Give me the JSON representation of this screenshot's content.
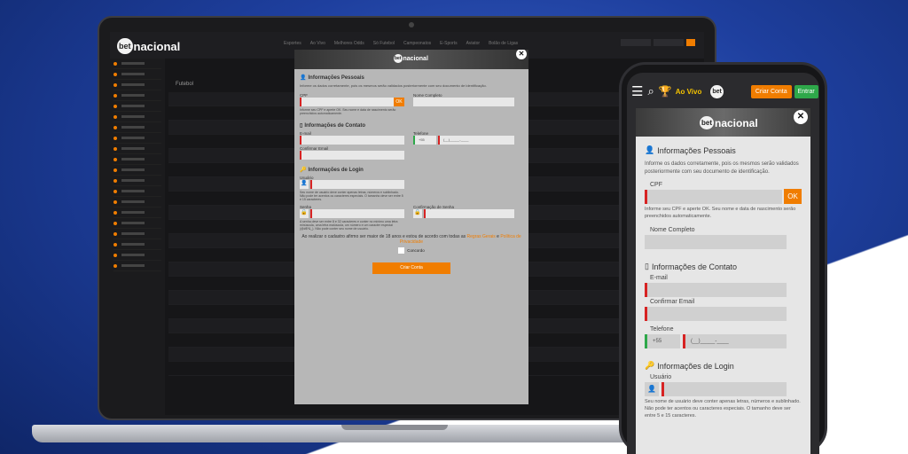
{
  "site": {
    "logo_text": "nacional",
    "logo_badge": "bet",
    "nav": [
      "Esportes",
      "Ao Vivo",
      "Melhores Odds",
      "Só Futebol",
      "Campeonatos",
      "E-Sports",
      "Aviator",
      "Bolão de Ligas"
    ],
    "section_title": "Futebol"
  },
  "modal": {
    "personal": {
      "heading": "Informações Pessoais",
      "intro": "Informe os dados corretamente, pois os mesmos serão validados posteriormente com seu documento de identificação.",
      "cpf_label": "CPF",
      "ok_label": "OK",
      "cpf_hint": "Informe seu CPF e aperte OK. Seu nome e data de nascimento serão preenchidos automaticamente.",
      "name_label": "Nome Completo"
    },
    "contact": {
      "heading": "Informações de Contato",
      "email_label": "E-mail",
      "confirm_email_label": "Confirmar Email",
      "phone_label": "Telefone",
      "country_code": "+55",
      "phone_placeholder": "(__)_____-____"
    },
    "login": {
      "heading": "Informações de Login",
      "user_label": "Usuário",
      "user_hint": "Seu nome de usuário deve conter apenas letras, números e sublinhado. Não pode ter acentos ou caracteres especiais. O tamanho deve ser entre 5 e 15 caracteres.",
      "password_label": "Senha",
      "password_confirm_label": "Confirmação de Senha",
      "password_hint": "A senha deve ser entre 8 e 32 caracteres e conter no mínimo uma letra minúscula, uma letra maiúscula, um número e um caracter especial (@#$*&_). Não pode conter seu nome de usuário."
    },
    "terms_text": "Ao realizar o cadastro afirmo ser maior de 18 anos e estou de acordo com todas as",
    "terms_link": "Regras Gerais",
    "terms_and": "e",
    "privacy_link": "Política de Privacidade",
    "agree_label": "Concordo",
    "submit_label": "Criar Conta"
  },
  "phone": {
    "live_label": "Ao Vivo",
    "create_account": "Criar Conta",
    "enter": "Entrar",
    "personal_heading": "Informações Pessoais",
    "intro": "Informe os dados corretamente, pois os mesmos serão validados posteriormente com seu documento de identificação.",
    "cpf_label": "CPF",
    "ok_label": "OK",
    "cpf_hint": "Informe seu CPF e aperte OK. Seu nome e data de nascimento serão preenchidos automaticamente.",
    "name_label": "Nome Completo",
    "contact_heading": "Informações de Contato",
    "email_label": "E-mail",
    "confirm_email_label": "Confirmar Email",
    "phone_label": "Telefone",
    "country_code": "+55",
    "phone_placeholder": "(__)_____-____",
    "login_heading": "Informações de Login",
    "user_label": "Usuário",
    "user_hint": "Seu nome de usuário deve conter apenas letras, números e sublinhado. Não pode ter acentos ou caracteres especiais. O tamanho deve ser entre 5 e 15 caracteres."
  },
  "colors": {
    "accent": "#f07d00",
    "required": "#d72323",
    "enter": "#2ea84a",
    "live": "#f5c300"
  }
}
